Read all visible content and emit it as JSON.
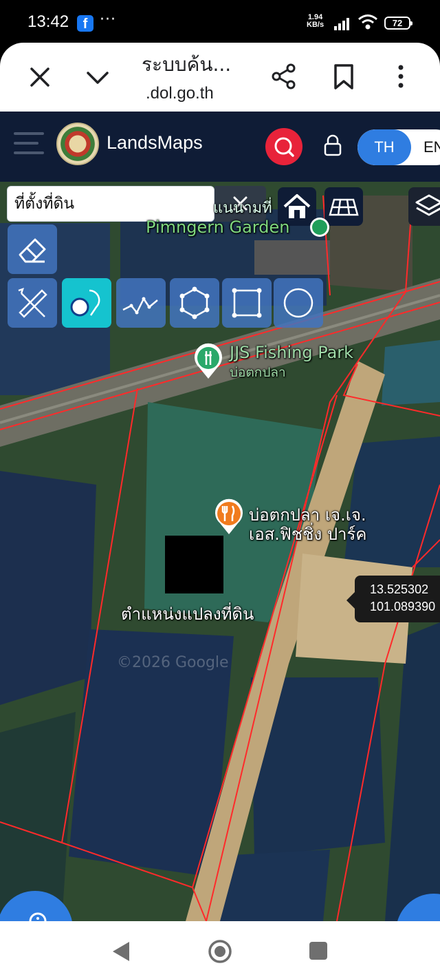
{
  "status_bar": {
    "time": "13:42",
    "app_badge": "f",
    "more": "···",
    "net_speed_value": "1.94",
    "net_speed_unit": "KB/s",
    "battery": "72"
  },
  "browser": {
    "page_title": "ระบบค้น...",
    "url": ".dol.go.th"
  },
  "app": {
    "name": "LandsMaps",
    "lang_active": "TH",
    "lang_other": "EN"
  },
  "map": {
    "search_value": "ที่ตั้งที่ดิน",
    "labels": {
      "garden_thai": "แนนามที่",
      "garden_en": "Pimngern Garden",
      "fishing_park_en": "JJS Fishing Park",
      "fishing_park_thai": "บ่อตกปลา",
      "poi_line1": "บ่อตกปลา เจ.เจ.",
      "poi_line2": "เอส.ฟิชชิ่ง ปาร์ค",
      "parcel_location": "ตำแหน่งแปลงที่ดิน",
      "watermark": "©2026 Google"
    },
    "coordinates": {
      "lat": "13.525302",
      "lon": "101.089390"
    },
    "colors": {
      "parcel_lines": "#ff2a2a",
      "tool_buttons": "#4274be",
      "active_tool": "#15c3cf",
      "header_bg": "#0f1c36",
      "search_accent": "#e8233a"
    }
  }
}
